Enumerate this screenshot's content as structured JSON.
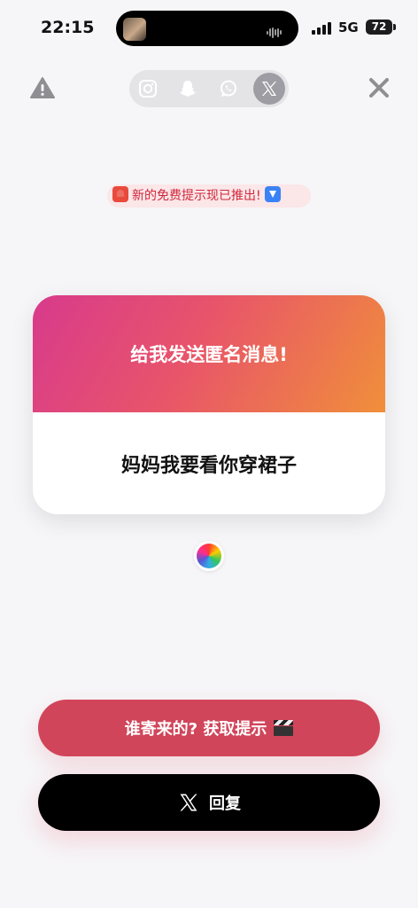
{
  "status_bar": {
    "time": "22:15",
    "network": "5G",
    "battery": "72"
  },
  "share_bar": {
    "items": [
      {
        "icon": "instagram-icon",
        "active": false
      },
      {
        "icon": "snapchat-icon",
        "active": false
      },
      {
        "icon": "whatsapp-icon",
        "active": false
      },
      {
        "icon": "x-icon",
        "active": true
      }
    ]
  },
  "announcement": {
    "text": "新的免费提示现已推出!",
    "leading_icon": "siren-icon",
    "trailing_icon": "down-arrow-icon"
  },
  "card": {
    "title": "给我发送匿名消息!",
    "message": "妈妈我要看你穿裙子"
  },
  "buttons": {
    "hint_label": "谁寄来的? 获取提示",
    "hint_icon": "clapper-icon",
    "reply_label": "回复",
    "reply_icon": "x-icon"
  },
  "colors": {
    "gradient_start": "#d83a8c",
    "gradient_end": "#f08f3a",
    "hint_button": "#d1455a",
    "reply_button": "#000000"
  }
}
